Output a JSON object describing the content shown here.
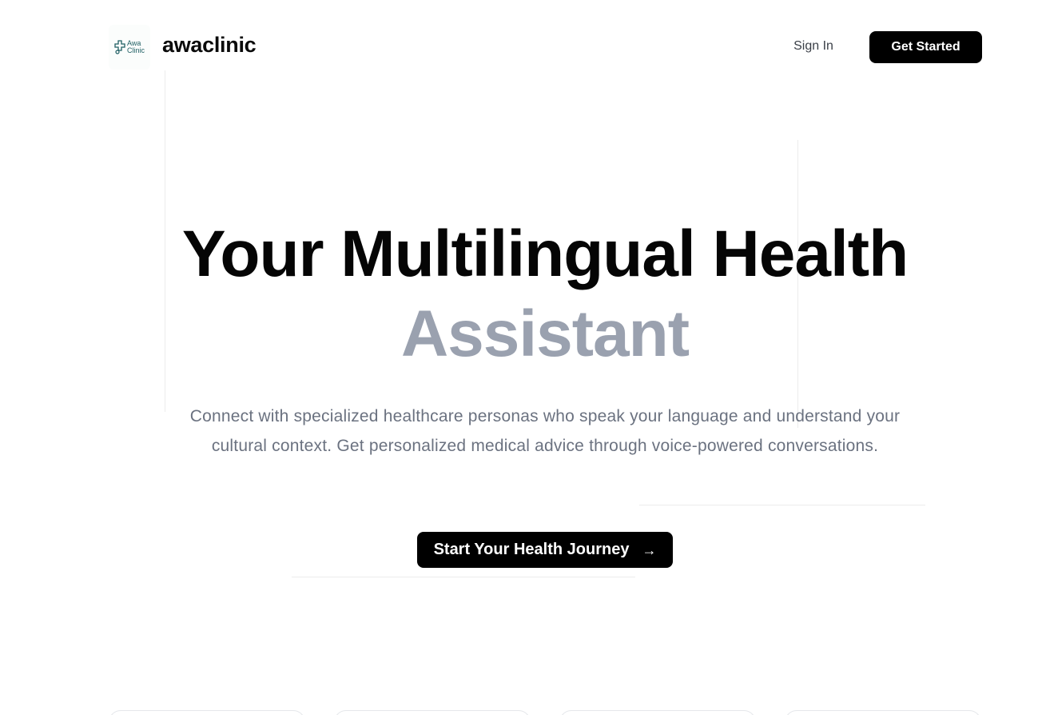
{
  "brand": {
    "logo_line1": "Awa",
    "logo_line2": "Clinic",
    "name": "awaclinic"
  },
  "nav": {
    "sign_in": "Sign In",
    "get_started": "Get Started"
  },
  "hero": {
    "title_line1": "Your Multilingual Health",
    "title_line2": "Assistant",
    "subtitle": "Connect with specialized healthcare personas who speak your language and understand your cultural context. Get personalized medical advice through voice-powered conversations.",
    "cta_label": "Start Your Health Journey",
    "cta_icon": "→"
  },
  "colors": {
    "primary": "#000000",
    "title": "#050505",
    "accent_title": "#9aa1af",
    "body_text": "#6b7280",
    "logo": "#1f5f63"
  }
}
